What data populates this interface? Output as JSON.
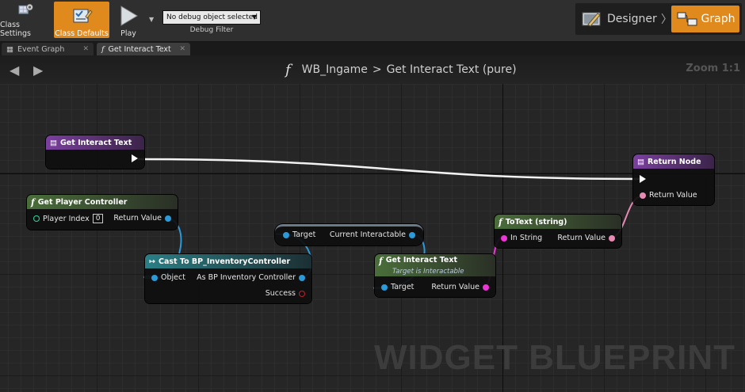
{
  "toolbar": {
    "class_settings": "Class Settings",
    "class_defaults": "Class Defaults",
    "play": "Play",
    "debug_select": "No debug object selected",
    "debug_label": "Debug Filter",
    "designer": "Designer",
    "graph": "Graph",
    "accent_color": "#e08a1e"
  },
  "tabs": [
    {
      "label": "Event Graph",
      "icon": "event-graph-icon"
    },
    {
      "label": "Get Interact Text",
      "icon": "function-icon"
    }
  ],
  "breadcrumb": {
    "widget": "WB_Ingame",
    "separator": ">",
    "function": "Get Interact Text (pure)",
    "zoom": "Zoom 1:1"
  },
  "watermark": "WIDGET BLUEPRINT",
  "nodes": {
    "entry": {
      "title": "Get Interact Text"
    },
    "get_player_controller": {
      "title": "Get Player Controller",
      "player_index_label": "Player Index",
      "player_index_value": "0",
      "return_value": "Return Value"
    },
    "cast": {
      "title": "Cast To BP_InventoryController",
      "object": "Object",
      "as_output": "As BP Inventory Controller",
      "success": "Success"
    },
    "get_property": {
      "target": "Target",
      "output": "Current Interactable"
    },
    "get_interact_text": {
      "title": "Get Interact Text",
      "subtitle": "Target is Interactable",
      "target": "Target",
      "return_value": "Return Value"
    },
    "to_text": {
      "title": "ToText (string)",
      "in_string": "In String",
      "return_value": "Return Value"
    },
    "return_node": {
      "title": "Return Node",
      "return_value": "Return Value"
    }
  },
  "colors": {
    "object_pin": "#2a9ad8",
    "text_pin": "#e01d9c",
    "string_pin": "#ee35d6",
    "function_header": "#3e5230",
    "entry_header": "#6c3d8e",
    "cast_header": "#25606a"
  }
}
